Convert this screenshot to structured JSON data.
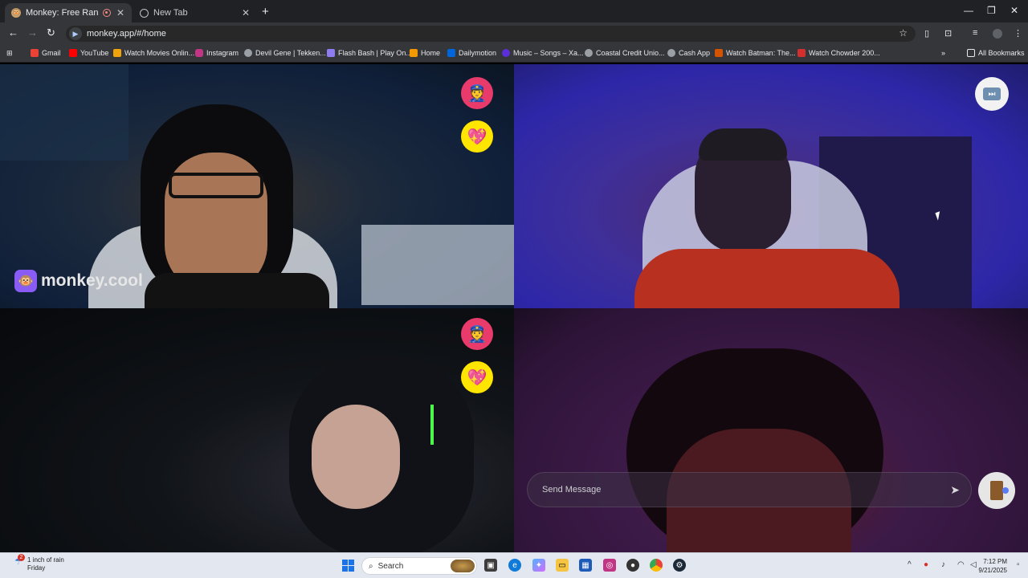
{
  "tabs": [
    {
      "title": "Monkey: Free Random Vide",
      "active": true
    },
    {
      "title": "New Tab",
      "active": false
    }
  ],
  "toolbar": {
    "url": "monkey.app/#/home"
  },
  "bookmarks": [
    {
      "label": "Gmail",
      "color": "#ea4335"
    },
    {
      "label": "YouTube",
      "color": "#ff0000"
    },
    {
      "label": "Watch Movies Onlin...",
      "color": "#f0a30a"
    },
    {
      "label": "Instagram",
      "color": "#c13584"
    },
    {
      "label": "Devil Gene | Tekken...",
      "color": "#9aa0a6"
    },
    {
      "label": "Flash Bash | Play On...",
      "color": "#8f7cf0"
    },
    {
      "label": "Home",
      "color": "#f29900"
    },
    {
      "label": "Dailymotion",
      "color": "#0066dc"
    },
    {
      "label": "Music – Songs – Xa...",
      "color": "#5b2fd8"
    },
    {
      "label": "Coastal Credit Unio...",
      "color": "#9aa0a6"
    },
    {
      "label": "Cash App",
      "color": "#9aa0a6"
    },
    {
      "label": "Watch Batman: The...",
      "color": "#d35400"
    },
    {
      "label": "Watch Chowder 200...",
      "color": "#d32f2f"
    }
  ],
  "all_bookmarks": "All Bookmarks",
  "brand": {
    "name": "monkey.cool"
  },
  "chat": {
    "placeholder": "Send Message"
  },
  "taskbar": {
    "weather_line1": "1 inch of rain",
    "weather_line2": "Friday",
    "weather_badge": "2",
    "search_label": "Search",
    "time": "7:12 PM",
    "date": "9/21/2025"
  }
}
